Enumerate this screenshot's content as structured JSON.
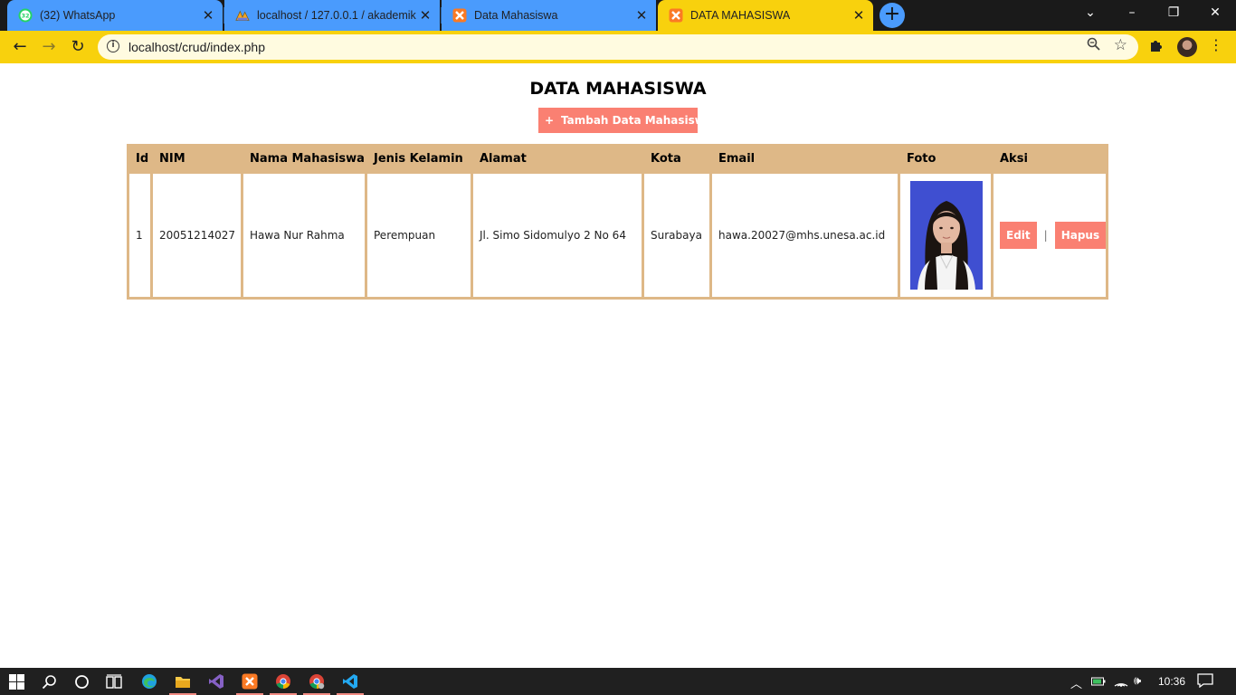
{
  "browser": {
    "tabs": [
      {
        "title": "(32) WhatsApp",
        "badge": "32",
        "icon": "whatsapp-icon",
        "active": false
      },
      {
        "title": "localhost / 127.0.0.1 / akademik /",
        "icon": "phpmyadmin-icon",
        "active": false
      },
      {
        "title": "Data Mahasiswa",
        "icon": "xampp-icon",
        "active": false
      },
      {
        "title": "DATA MAHASISWA",
        "icon": "xampp-icon",
        "active": true
      }
    ],
    "new_tab": "+",
    "url": "localhost/crud/index.php",
    "accent_color": "#f8d10d",
    "tab_color": "#4a9bfd"
  },
  "page": {
    "title": "DATA MAHASISWA",
    "add_button": {
      "icon": "+",
      "label": "Tambah Data Mahasiswa"
    },
    "table": {
      "headers": [
        "Id",
        "NIM",
        "Nama Mahasiswa",
        "Jenis Kelamin",
        "Alamat",
        "Kota",
        "Email",
        "Foto",
        "Aksi"
      ],
      "rows": [
        {
          "id": "1",
          "nim": "20051214027",
          "nama": "Hawa Nur Rahma",
          "jenis_kelamin": "Perempuan",
          "alamat": "Jl. Simo Sidomulyo 2 No 64",
          "kota": "Surabaya",
          "email": "hawa.20027@mhs.unesa.ac.id",
          "foto": "student-photo",
          "edit_label": "Edit",
          "separator": "|",
          "delete_label": "Hapus"
        }
      ]
    },
    "button_color": "#fa8072",
    "table_border_color": "#deb887"
  },
  "taskbar": {
    "clock": "10:36",
    "apps": [
      "start-icon",
      "search-icon",
      "cortana-icon",
      "task-view-icon",
      "edge-icon",
      "file-explorer-icon",
      "visual-studio-icon",
      "xampp-icon",
      "chrome-icon",
      "chrome-alt-icon",
      "vscode-icon"
    ]
  }
}
